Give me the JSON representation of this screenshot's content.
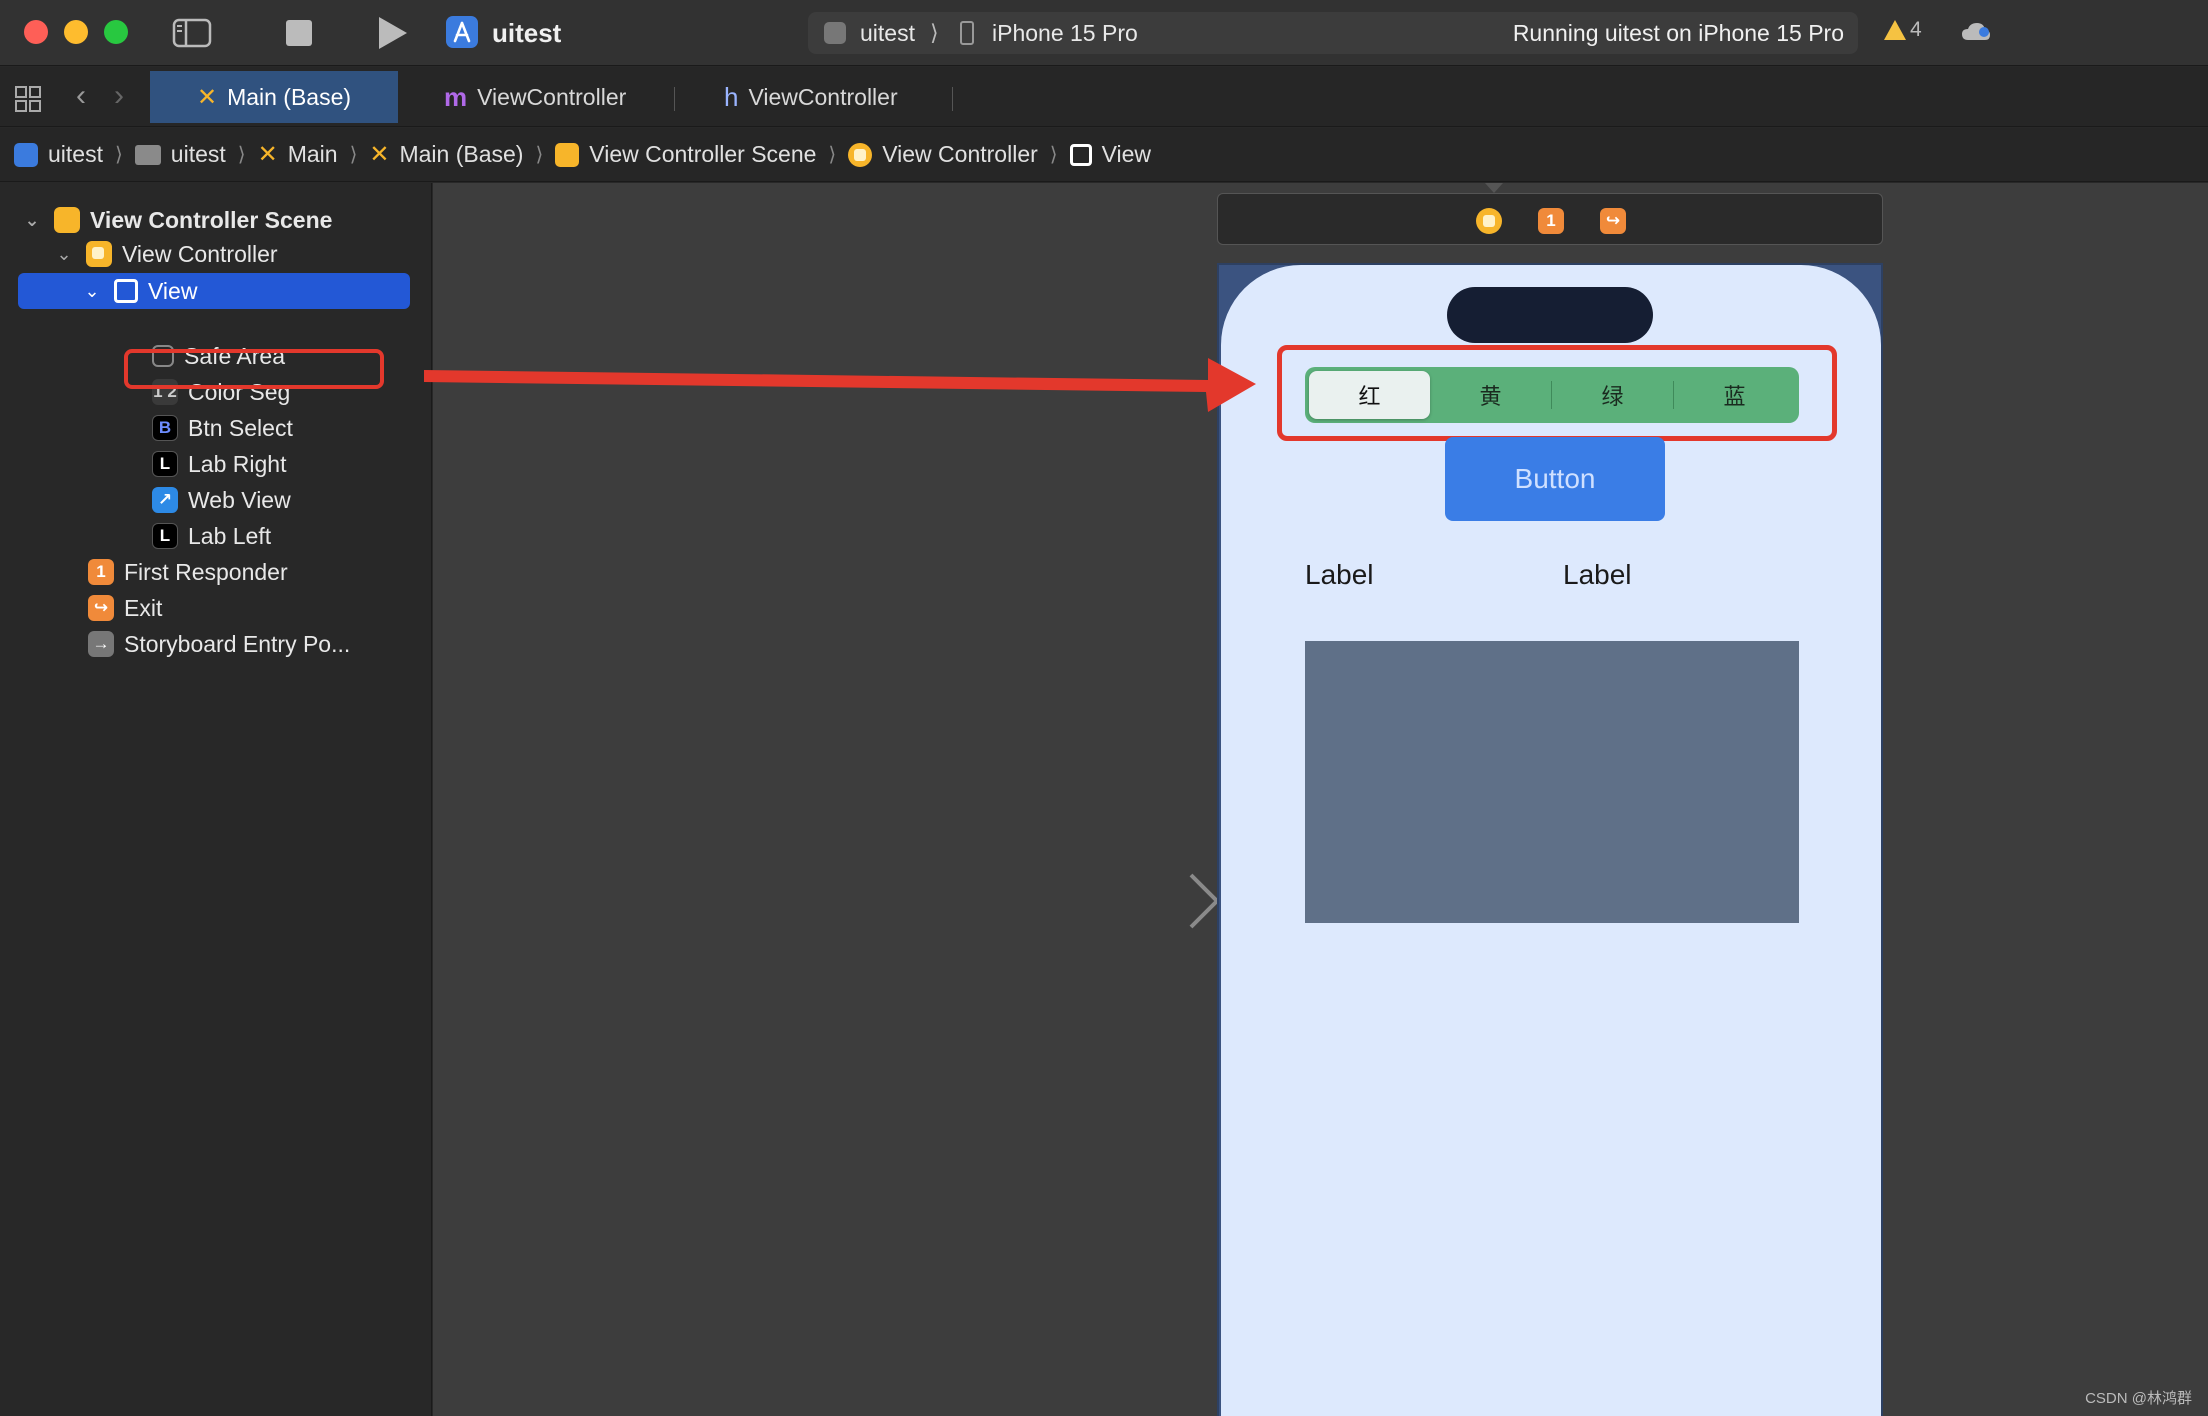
{
  "titlebar": {
    "app_name": "uitest",
    "scheme": "uitest",
    "scheme_sep": "⟩",
    "device": "iPhone 15 Pro",
    "status": "Running uitest on iPhone 15 Pro",
    "warning_count": "4"
  },
  "tabs": [
    {
      "glyph": "✕",
      "label": "Main (Base)"
    },
    {
      "glyph": "m",
      "label": "ViewController"
    },
    {
      "glyph": "h",
      "label": "ViewController"
    }
  ],
  "nav": {
    "back": "‹",
    "forward": "›"
  },
  "breadcrumb": {
    "chevron": "⟩",
    "items": [
      "uitest",
      "uitest",
      "Main",
      "Main (Base)",
      "View Controller Scene",
      "View Controller",
      "View"
    ]
  },
  "outline": {
    "disclosure": "⌄",
    "scene": "View Controller Scene",
    "view_controller": "View Controller",
    "view": "View",
    "children": [
      {
        "icon": "",
        "label": "Safe Area"
      },
      {
        "icon": "1 2",
        "label": "Color Seg"
      },
      {
        "icon": "B",
        "label": "Btn Select"
      },
      {
        "icon": "L",
        "label": "Lab Right"
      },
      {
        "icon": "↗",
        "label": "Web View"
      },
      {
        "icon": "L",
        "label": "Lab Left"
      }
    ],
    "first_responder_icon": "1",
    "first_responder": "First Responder",
    "exit_icon": "↪",
    "exit": "Exit",
    "entry_icon": "→",
    "entry": "Storyboard Entry Po..."
  },
  "scene_dock": {
    "first_responder_icon": "1",
    "exit_icon": "↪"
  },
  "phone": {
    "segments": [
      "红",
      "黄",
      "绿",
      "蓝"
    ],
    "selected_segment": 0,
    "button_label": "Button",
    "label_left": "Label",
    "label_right": "Label"
  },
  "colors": {
    "accent_red": "#e3382c",
    "selection_blue": "#2358d6",
    "segment_green": "#5bb07a",
    "button_blue": "#3a7de6"
  },
  "watermark": "CSDN @林鸿群"
}
